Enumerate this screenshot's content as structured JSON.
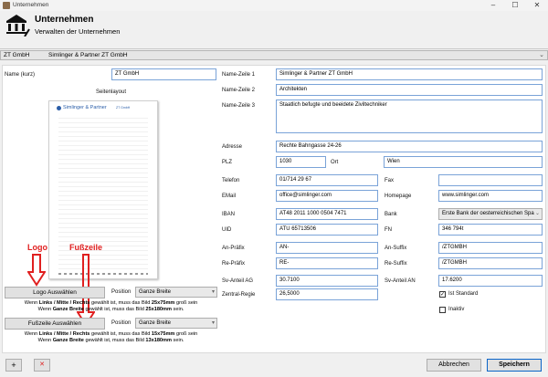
{
  "window": {
    "title": "Unternehmen",
    "minimize": "–",
    "maximize": "☐",
    "close": "✕"
  },
  "header": {
    "title": "Unternehmen",
    "subtitle": "Verwalten der Unternehmen"
  },
  "company_select": {
    "short": "ZT GmbH",
    "name": "Simlinger & Partner ZT GmbH"
  },
  "left": {
    "name_kurz_label": "Name (kurz)",
    "name_kurz_value": "ZT GmbH",
    "seitenlayout_label": "Seitenlayout",
    "preview_logo_text": "Simlinger & Partner",
    "preview_logo_suffix": "ZT GmbH",
    "logo_button": "Logo Auswählen",
    "position_label": "Position",
    "logo_position": "Ganze Breite",
    "footer_button": "Fußzeile Auswählen",
    "footer_position": "Ganze Breite",
    "logo_note_1a": "Wenn ",
    "logo_note_1b": "Links / Mitte / Rechts",
    "logo_note_1c": " gewählt ist, muss das Bild ",
    "logo_note_1d": "25x75mm",
    "logo_note_1e": " groß sein",
    "logo_note_2a": "Wenn ",
    "logo_note_2b": "Ganze Breite",
    "logo_note_2c": " gewählt ist, muss das Bild ",
    "logo_note_2d": "25x180mm",
    "logo_note_2e": " sein.",
    "footer_note_1d": "15x75mm",
    "footer_note_2d": "13x180mm",
    "annotation_logo": "Logo",
    "annotation_footer": "Fußzeile"
  },
  "fields": {
    "name1_label": "Name-Zeile 1",
    "name1": "Simlinger & Partner ZT GmbH",
    "name2_label": "Name-Zeile 2",
    "name2": "Architekten",
    "name3_label": "Name-Zeile 3",
    "name3": "Staatlich befugte und beeidete Ziviltechniker",
    "adresse_label": "Adresse",
    "adresse": "Rechte Bahngasse 24-26",
    "plz_label": "PLZ",
    "plz": "1030",
    "ort_label": "Ort",
    "ort": "Wien",
    "telefon_label": "Telefon",
    "telefon": "01/714 29 67",
    "fax_label": "Fax",
    "fax": "",
    "email_label": "EMail",
    "email": "office@simlinger.com",
    "homepage_label": "Homepage",
    "homepage": "www.simlinger.com",
    "iban_label": "IBAN",
    "iban": "AT48 2011 1000 0504 7471",
    "bank_label": "Bank",
    "bank": "Erste Bank der oesterreichischen Spark",
    "uid_label": "UID",
    "uid": "ATU 65713506",
    "fn_label": "FN",
    "fn": "346 794t",
    "an_praefix_label": "An-Präfix",
    "an_praefix": "AN-",
    "an_suffix_label": "An-Suffix",
    "an_suffix": "/ZTGMBH",
    "re_praefix_label": "Re-Präfix",
    "re_praefix": "RE-",
    "re_suffix_label": "Re-Suffix",
    "re_suffix": "/ZTGMBH",
    "sv_ag_label": "Sv-Anteil AG",
    "sv_ag": "30.7100",
    "sv_an_label": "Sv-Anteil AN",
    "sv_an": "17.6200",
    "zentral_label": "Zentral-Regie",
    "zentral": "26,5000",
    "ist_standard_label": "Ist Standard",
    "ist_standard_checked": true,
    "inaktiv_label": "Inaktiv",
    "inaktiv_checked": false
  },
  "footer": {
    "add": "+",
    "delete": "✕",
    "cancel": "Abbrechen",
    "save": "Speichern"
  },
  "colors": {
    "accent_border": "#7aa3d8",
    "annotation_red": "#e02020"
  }
}
